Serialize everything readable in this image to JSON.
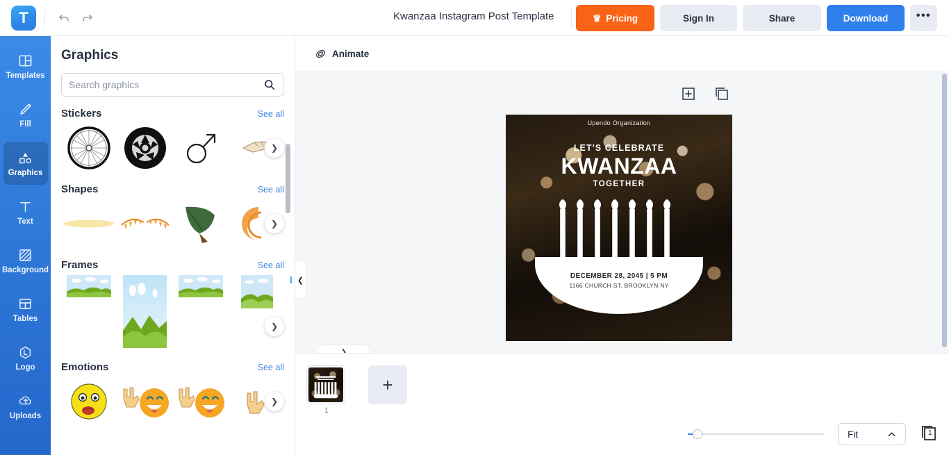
{
  "topbar": {
    "logo_letter": "T",
    "logo_icon": "app-logo",
    "undo_icon": "undo-arrow-icon",
    "redo_icon": "redo-arrow-icon",
    "doc_title": "Kwanzaa Instagram Post Template",
    "pricing_label": "Pricing",
    "pricing_icon": "crown-icon",
    "signin_label": "Sign In",
    "share_label": "Share",
    "download_label": "Download",
    "more_label": "•••",
    "colors": {
      "pricing_bg": "#f96316",
      "download_bg": "#2f80ed",
      "neutral_btn_bg": "#e8ebf2"
    }
  },
  "rail": {
    "items": [
      {
        "label": "Templates",
        "icon": "templates-icon",
        "active": false
      },
      {
        "label": "Fill",
        "icon": "pencil-icon",
        "active": false
      },
      {
        "label": "Graphics",
        "icon": "shapes-icon",
        "active": true
      },
      {
        "label": "Text",
        "icon": "text-t-icon",
        "active": false
      },
      {
        "label": "Background",
        "icon": "background-hatch-icon",
        "active": false
      },
      {
        "label": "Tables",
        "icon": "table-grid-icon",
        "active": false
      },
      {
        "label": "Logo",
        "icon": "logo-hexagon-icon",
        "active": false
      },
      {
        "label": "Uploads",
        "icon": "upload-cloud-icon",
        "active": false
      }
    ],
    "bg_color": "#2f7fe0"
  },
  "panel": {
    "title": "Graphics",
    "search": {
      "placeholder": "Search graphics",
      "value": "",
      "icon": "search-icon"
    },
    "see_all_label": "See all",
    "next_icon": "chevron-right-icon",
    "sections": [
      {
        "name": "Stickers",
        "items": [
          "bicycle-wheel",
          "car-tire",
          "mars-symbol",
          "pointing-hand"
        ]
      },
      {
        "name": "Shapes",
        "items": [
          "yellow-ellipse",
          "orange-garland",
          "green-leaf",
          "orange-swirl"
        ]
      },
      {
        "name": "Frames",
        "items": [
          "landscape-wide",
          "landscape-tall",
          "landscape-wide-2",
          "landscape-square"
        ]
      },
      {
        "name": "Emotions",
        "items": [
          "shocked-face",
          "rock-on-grin",
          "rock-on-grin-2",
          "rock-on-hand"
        ]
      }
    ],
    "collapse_icon": "chevron-left-icon"
  },
  "canvas": {
    "animate_label": "Animate",
    "animate_icon": "animate-layers-icon",
    "add_tool_icon": "add-page-icon",
    "duplicate_tool_icon": "duplicate-icon",
    "grip_icon": "chevron-down-icon"
  },
  "design": {
    "organization": "Upendo Organization",
    "pre_headline": "LET'S CELEBRATE",
    "headline": "KWANZAA",
    "post_headline": "TOGETHER",
    "date_line": "DECEMBER 28, 2045  |  5 PM",
    "address_line": "1166 CHURCH ST. BROOKLYN NY",
    "candle_count": 7,
    "graphic": "kwanzaa-kinara-candles"
  },
  "pages": {
    "thumb_number": "1",
    "add_page_label": "+",
    "add_page_icon": "plus-icon"
  },
  "zoom": {
    "value": 6,
    "fit_label": "Fit",
    "fit_chevron_icon": "chevron-up-icon",
    "page_count": "1",
    "page_count_icon": "pages-stack-icon"
  }
}
